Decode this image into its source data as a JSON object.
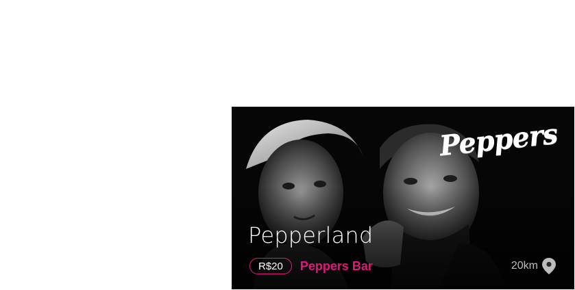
{
  "event": {
    "title": "Pepperland",
    "price": "R$20",
    "venue": "Peppers Bar",
    "distance": "20km",
    "logo_text": "Peppers",
    "photo": "two-men-black-and-white-portrait",
    "location_icon": "map-pin-icon"
  },
  "colors": {
    "accent": "#e2177b",
    "card_bg": "#050505",
    "muted_text": "#bdbdbd"
  }
}
